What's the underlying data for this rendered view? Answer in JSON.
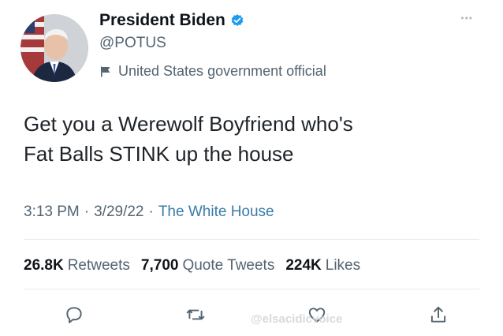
{
  "author": {
    "display_name": "President Biden",
    "handle": "@POTUS",
    "label": "United States government official",
    "verified_icon": "verified-badge-icon",
    "label_icon": "flag-icon"
  },
  "tweet": {
    "text_line1": "Get you a Werewolf Boyfriend who's",
    "text_line2": "Fat Balls STINK up the house",
    "time": "3:13 PM",
    "date": "3/29/22",
    "source": "The White House",
    "separator": "·"
  },
  "stats": {
    "retweets_count": "26.8K",
    "retweets_label": "Retweets",
    "quotes_count": "7,700",
    "quotes_label": "Quote Tweets",
    "likes_count": "224K",
    "likes_label": "Likes"
  },
  "actions": [
    "reply-icon",
    "retweet-icon",
    "like-icon",
    "share-icon"
  ],
  "watermark": {
    "text": "@elsacidicvoice"
  },
  "colors": {
    "text": "#0f1419",
    "muted": "#536471",
    "link": "#3a7ca8",
    "verified": "#1d9bf0",
    "divider": "#e6e9ec"
  }
}
